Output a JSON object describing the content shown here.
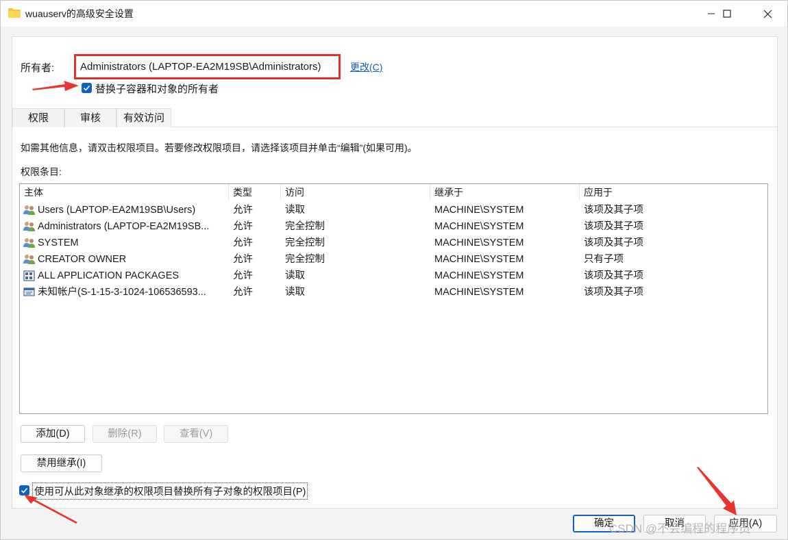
{
  "window": {
    "title": "wuauserv的高级安全设置"
  },
  "owner": {
    "label": "所有者:",
    "value": "Administrators (LAPTOP-EA2M19SB\\Administrators)",
    "change_link": "更改(C)",
    "replace_checkbox_label": "替换子容器和对象的所有者",
    "replace_checked": true
  },
  "tabs": [
    {
      "label": "权限",
      "active": true
    },
    {
      "label": "审核",
      "active": false
    },
    {
      "label": "有效访问",
      "active": false
    }
  ],
  "info_text": "如需其他信息，请双击权限项目。若要修改权限项目，请选择该项目并单击“编辑”(如果可用)。",
  "entries_label": "权限条目:",
  "table": {
    "headers": [
      "主体",
      "类型",
      "访问",
      "继承于",
      "应用于"
    ],
    "rows": [
      {
        "principal": "Users (LAPTOP-EA2M19SB\\Users)",
        "type": "允许",
        "access": "读取",
        "inherited": "MACHINE\\SYSTEM",
        "applies": "该项及其子项",
        "icon": "users-group-icon"
      },
      {
        "principal": "Administrators (LAPTOP-EA2M19SB...",
        "type": "允许",
        "access": "完全控制",
        "inherited": "MACHINE\\SYSTEM",
        "applies": "该项及其子项",
        "icon": "users-group-icon"
      },
      {
        "principal": "SYSTEM",
        "type": "允许",
        "access": "完全控制",
        "inherited": "MACHINE\\SYSTEM",
        "applies": "该项及其子项",
        "icon": "users-group-icon"
      },
      {
        "principal": "CREATOR OWNER",
        "type": "允许",
        "access": "完全控制",
        "inherited": "MACHINE\\SYSTEM",
        "applies": "只有子项",
        "icon": "users-group-icon"
      },
      {
        "principal": "ALL APPLICATION PACKAGES",
        "type": "允许",
        "access": "读取",
        "inherited": "MACHINE\\SYSTEM",
        "applies": "该项及其子项",
        "icon": "app-packages-icon"
      },
      {
        "principal": "未知帐户(S-1-15-3-1024-106536593...",
        "type": "允许",
        "access": "读取",
        "inherited": "MACHINE\\SYSTEM",
        "applies": "该项及其子项",
        "icon": "unknown-account-icon"
      }
    ]
  },
  "buttons": {
    "add": "添加(D)",
    "remove": "删除(R)",
    "view": "查看(V)",
    "disable_inheritance": "禁用继承(I)",
    "ok": "确定",
    "cancel": "取消",
    "apply": "应用(A)"
  },
  "replace_child_checkbox": {
    "label": "使用可从此对象继承的权限项目替换所有子对象的权限项目(P)",
    "checked": true
  },
  "watermark": "CSDN @不会编程的程序员",
  "colors": {
    "accent": "#0f62bf",
    "highlight_box": "#e0322d",
    "arrow": "#e8342e",
    "link": "#0f5fc2"
  }
}
